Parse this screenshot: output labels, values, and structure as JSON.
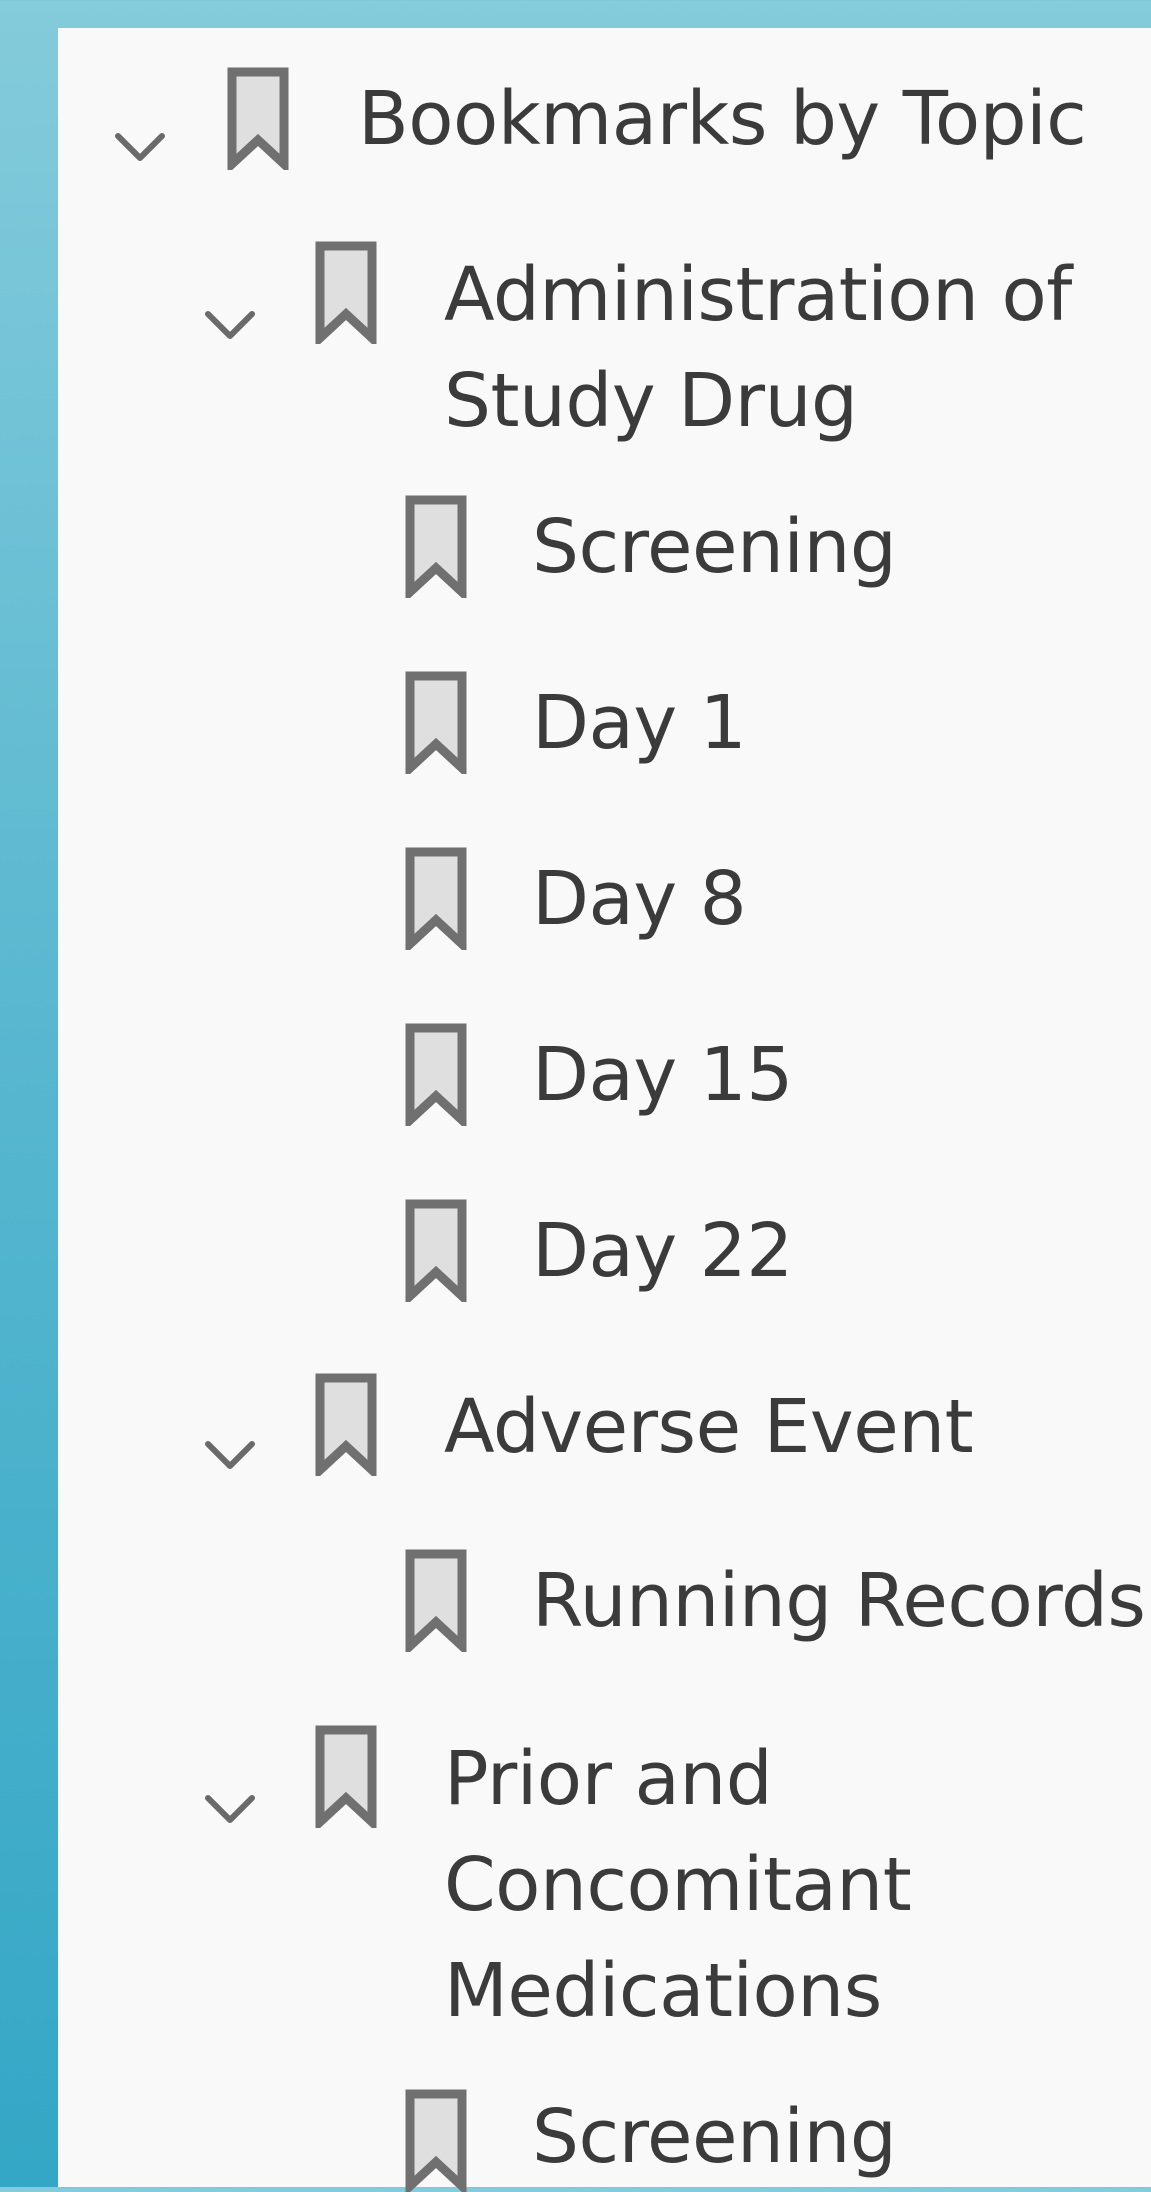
{
  "bookmarks_panel": {
    "root": {
      "label": "Bookmarks by Topic",
      "groups": [
        {
          "label": "Administration of\nStudy Drug",
          "children": [
            "Screening",
            "Day 1",
            "Day 8",
            "Day 15",
            "Day 22"
          ]
        },
        {
          "label": "Adverse Event",
          "children": [
            "Running Records"
          ]
        },
        {
          "label": "Prior and\nConcomitant\nMedications",
          "children": [
            "Screening"
          ]
        }
      ]
    }
  }
}
